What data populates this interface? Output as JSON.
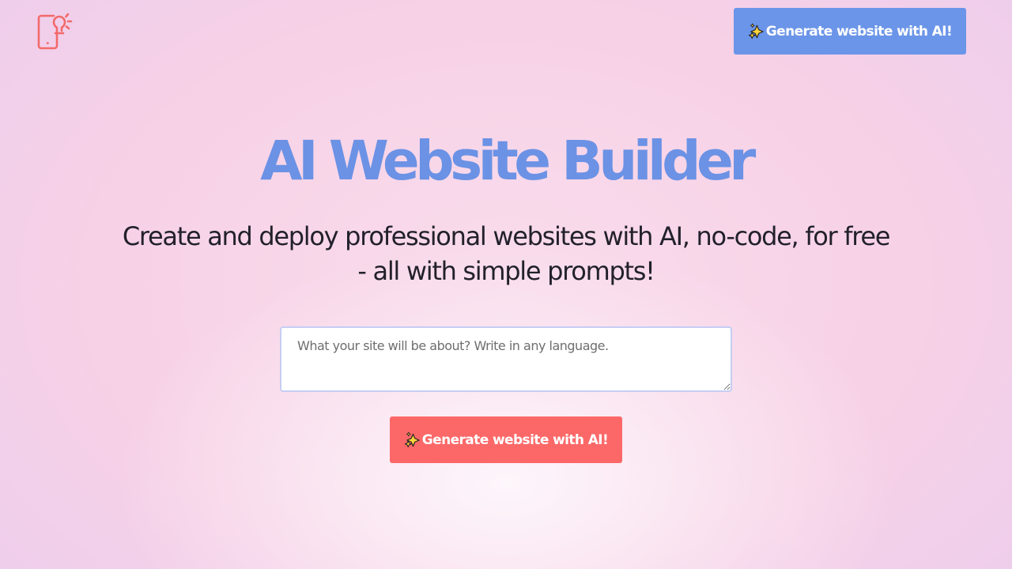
{
  "header": {
    "logo_icon": "phone-idea-icon",
    "cta_icon": "sparkles-icon",
    "cta_label": "Generate website with AI!"
  },
  "hero": {
    "title": "AI Website Builder",
    "subtitle": "Create and deploy professional websites with AI, no-code, for free - all with simple prompts!"
  },
  "form": {
    "prompt_placeholder": "What your site will be about? Write in any language.",
    "prompt_value": "",
    "submit_icon": "sparkles-icon",
    "submit_label": "Generate website with AI!"
  },
  "colors": {
    "accent_blue": "#6b95e8",
    "accent_red": "#fc6868",
    "title_color": "#6b92e5",
    "logo_color": "#f26a6a"
  }
}
